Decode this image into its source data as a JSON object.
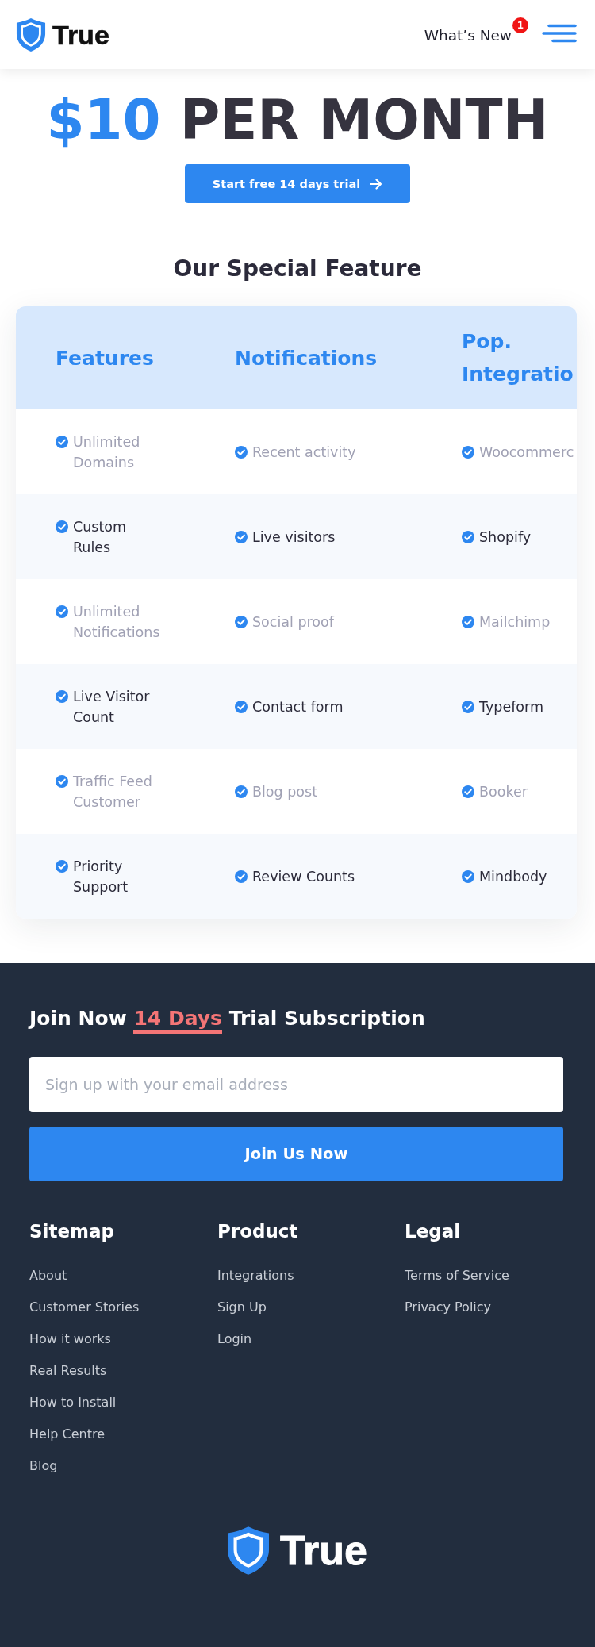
{
  "header": {
    "logo": "True",
    "whats_new": {
      "label": "What’s New",
      "badge": "1"
    }
  },
  "pricing": {
    "price": "$10",
    "period": "PER MONTH",
    "cta": "Start free 14 days trial"
  },
  "features": {
    "title": "Our Special Feature",
    "columns": [
      "Features",
      "Notifications",
      "Pop. Integratio"
    ],
    "rows": [
      [
        "Unlimited Domains",
        "Recent activity",
        "Woocommerc"
      ],
      [
        "Custom Rules",
        "Live visitors",
        "Shopify"
      ],
      [
        "Unlimited Notifications",
        "Social proof",
        "Mailchimp"
      ],
      [
        "Live Visitor Count",
        "Contact form",
        "Typeform"
      ],
      [
        "Traffic Feed Customer",
        "Blog post",
        "Booker"
      ],
      [
        "Priority Support",
        "Review Counts",
        "Mindbody"
      ]
    ]
  },
  "footer": {
    "signup": {
      "title_parts": [
        {
          "text": "Join Now",
          "highlighted": false
        },
        {
          "text": "14 Days",
          "highlighted": true
        },
        {
          "text": "Trial Subscription",
          "highlighted": false
        }
      ],
      "placeholder": "Sign up with your email address",
      "button": "Join Us Now"
    },
    "columns": [
      {
        "title": "Sitemap",
        "links": [
          "About",
          "Customer Stories",
          "How it works",
          "Real Results",
          "How to Install",
          "Help Centre",
          "Blog"
        ]
      },
      {
        "title": "Product",
        "links": [
          "Integrations",
          "Sign Up",
          "Login"
        ]
      },
      {
        "title": "Legal",
        "links": [
          "Terms of Service",
          "Privacy Policy"
        ]
      }
    ],
    "logo": "True"
  }
}
